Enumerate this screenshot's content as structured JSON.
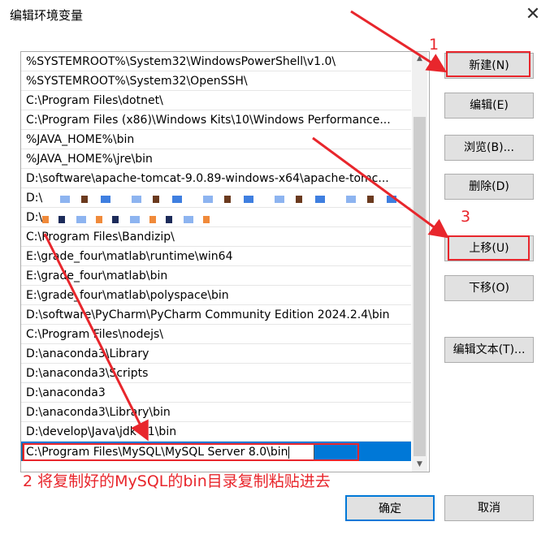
{
  "window": {
    "title": "编辑环境变量",
    "close_glyph": "✕"
  },
  "path_list": {
    "entries": [
      "%SYSTEMROOT%\\System32\\WindowsPowerShell\\v1.0\\",
      "%SYSTEMROOT%\\System32\\OpenSSH\\",
      "C:\\Program Files\\dotnet\\",
      "C:\\Program Files (x86)\\Windows Kits\\10\\Windows Performance...",
      "%JAVA_HOME%\\bin",
      "%JAVA_HOME%\\jre\\bin",
      "D:\\software\\apache-tomcat-9.0.89-windows-x64\\apache-tomc...",
      "D:\\",
      "D:\\",
      "C:\\Program Files\\Bandizip\\",
      "E:\\grade_four\\matlab\\runtime\\win64",
      "E:\\grade_four\\matlab\\bin",
      "E:\\grade_four\\matlab\\polyspace\\bin",
      "D:\\software\\PyCharm\\PyCharm Community Edition 2024.2.4\\bin",
      "C:\\Program Files\\nodejs\\",
      "D:\\anaconda3\\Library",
      "D:\\anaconda3\\Scripts",
      "D:\\anaconda3",
      "D:\\anaconda3\\Library\\bin",
      "D:\\develop\\Java\\jdk-21\\bin"
    ],
    "editing_value": "C:\\Program Files\\MySQL\\MySQL Server 8.0\\bin"
  },
  "buttons": {
    "new": "新建(N)",
    "edit": "编辑(E)",
    "browse": "浏览(B)...",
    "delete": "删除(D)",
    "move_up": "上移(U)",
    "move_down": "下移(O)",
    "edit_text": "编辑文本(T)...",
    "ok": "确定",
    "cancel": "取消"
  },
  "annotations": {
    "step1": "1",
    "step2": "2 将复制好的MySQL的bin目录复制粘贴进去",
    "step3": "3",
    "color": "#e8262c"
  },
  "colors": {
    "selection": "#0078d7",
    "accent_border": "#0078d7"
  }
}
